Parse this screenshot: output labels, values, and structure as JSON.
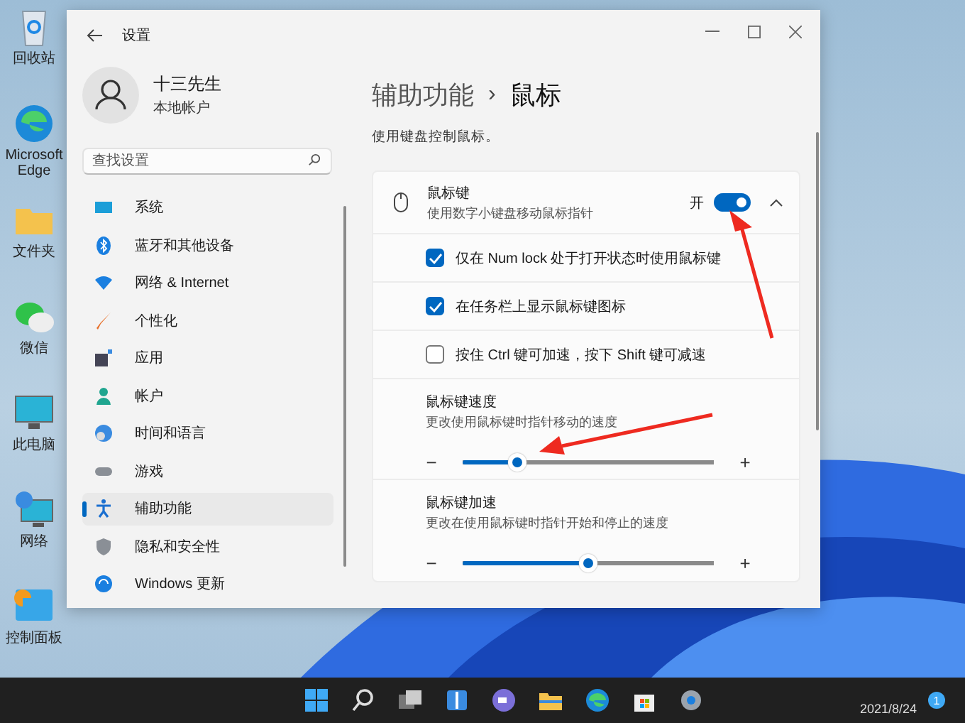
{
  "desktop_icons": [
    {
      "kind": "recycle",
      "label": "回收站"
    },
    {
      "kind": "edge",
      "label": "Microsoft Edge"
    },
    {
      "kind": "folder",
      "label": "文件夹"
    },
    {
      "kind": "wechat",
      "label": "微信"
    },
    {
      "kind": "pc",
      "label": "此电脑"
    },
    {
      "kind": "network",
      "label": "网络"
    },
    {
      "kind": "control",
      "label": "控制面板"
    }
  ],
  "window": {
    "title": "设置",
    "user": {
      "name": "十三先生",
      "account": "本地帐户"
    },
    "search": {
      "placeholder": "查找设置"
    },
    "nav": [
      {
        "kind": "system",
        "label": "系统",
        "selected": false
      },
      {
        "kind": "bluetooth",
        "label": "蓝牙和其他设备",
        "selected": false
      },
      {
        "kind": "network",
        "label": "网络 & Internet",
        "selected": false
      },
      {
        "kind": "brush",
        "label": "个性化",
        "selected": false
      },
      {
        "kind": "apps",
        "label": "应用",
        "selected": false
      },
      {
        "kind": "account",
        "label": "帐户",
        "selected": false
      },
      {
        "kind": "time",
        "label": "时间和语言",
        "selected": false
      },
      {
        "kind": "game",
        "label": "游戏",
        "selected": false
      },
      {
        "kind": "access",
        "label": "辅助功能",
        "selected": true
      },
      {
        "kind": "shield",
        "label": "隐私和安全性",
        "selected": false
      },
      {
        "kind": "update",
        "label": "Windows 更新",
        "selected": false
      }
    ],
    "breadcrumb": {
      "parent": "辅助功能",
      "separator": "›",
      "current": "鼠标"
    },
    "description": "使用键盘控制鼠标。",
    "mouse_keys": {
      "title": "鼠标键",
      "subtitle": "使用数字小键盘移动鼠标指针",
      "state_label": "开",
      "on": true,
      "expanded": true,
      "options": [
        {
          "label": "仅在 Num lock 处于打开状态时使用鼠标键",
          "checked": true
        },
        {
          "label": "在任务栏上显示鼠标键图标",
          "checked": true
        },
        {
          "label": "按住 Ctrl 键可加速，按下 Shift 键可减速",
          "checked": false
        }
      ],
      "sliders": [
        {
          "title": "鼠标键速度",
          "description": "更改使用鼠标键时指针移动的速度",
          "minus": "−",
          "plus": "+",
          "level": 0.22
        },
        {
          "title": "鼠标键加速",
          "description": "更改在使用鼠标键时指针开始和停止的速度",
          "minus": "−",
          "plus": "+",
          "level": 0.5
        }
      ]
    }
  },
  "taskbar": {
    "icons": [
      {
        "kind": "start"
      },
      {
        "kind": "search"
      },
      {
        "kind": "taskview"
      },
      {
        "kind": "widgets"
      },
      {
        "kind": "chat"
      },
      {
        "kind": "explorer"
      },
      {
        "kind": "edge"
      },
      {
        "kind": "store"
      },
      {
        "kind": "settings"
      }
    ],
    "date": "2021/8/24",
    "notification_count": "1"
  }
}
